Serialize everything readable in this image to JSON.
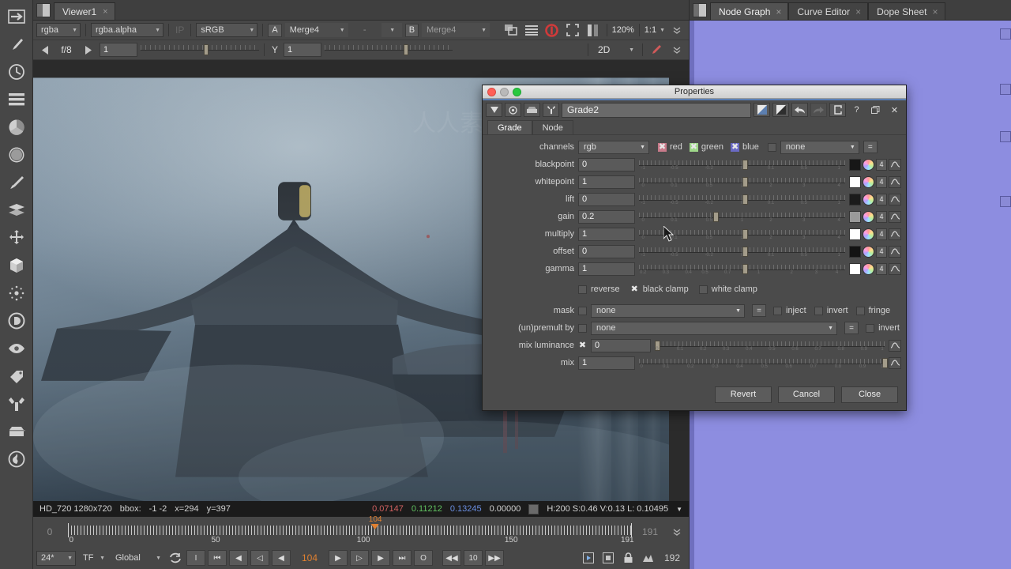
{
  "left_toolbar": {
    "tools": [
      {
        "name": "transform-node-icon",
        "label": "Transform"
      },
      {
        "name": "paint-brush-icon",
        "label": "Draw"
      },
      {
        "name": "time-clock-icon",
        "label": "Time"
      },
      {
        "name": "layers-stack-icon",
        "label": "Channel"
      },
      {
        "name": "color-wheel-icon",
        "label": "Color"
      },
      {
        "name": "filter-sphere-icon",
        "label": "Filter"
      },
      {
        "name": "keyer-eyedropper-icon",
        "label": "Keyer"
      },
      {
        "name": "merge-layers-icon",
        "label": "Merge"
      },
      {
        "name": "transform-move-icon",
        "label": "Transform"
      },
      {
        "name": "cube-3d-icon",
        "label": "3D"
      },
      {
        "name": "particles-icon",
        "label": "Particles"
      },
      {
        "name": "deep-d-icon",
        "label": "Deep"
      },
      {
        "name": "views-eye-icon",
        "label": "Views"
      },
      {
        "name": "metadata-tag-icon",
        "label": "Metadata"
      },
      {
        "name": "toolsets-wrench-icon",
        "label": "Toolsets"
      },
      {
        "name": "other-box-icon",
        "label": "Other"
      },
      {
        "name": "furnace-icon",
        "label": "Furnace"
      }
    ]
  },
  "viewer": {
    "tab_label": "Viewer1",
    "tab_close": "×",
    "channel_set": "rgba",
    "channel": "rgba.alpha",
    "ip_label": "IP",
    "colorspace": "sRGB",
    "input_a_label": "A",
    "input_a": "Merge4",
    "input_dash": "-",
    "input_b_label": "B",
    "input_b": "Merge4",
    "zoom": "120%",
    "ratio": "1:1",
    "gain_stop": "f/8",
    "gain_value": "1",
    "gamma_label": "Y",
    "gamma_value": "1",
    "view_mode": "2D",
    "icons": {
      "proxy": "proxy-icon",
      "lines": "lines-icon",
      "refresh": "refresh-icon",
      "roi": "region-of-interest-icon",
      "wipe": "wipe-icon",
      "chevron": "chevron-down-icon",
      "pen": "pen-icon"
    }
  },
  "status": {
    "format": "HD_720 1280x720",
    "bbox_label": "bbox:",
    "bbox_value": "-1 -2",
    "x": "x=294",
    "y": "y=397",
    "red": "0.07147",
    "green": "0.11212",
    "blue": "0.13245",
    "alpha": "0.00000",
    "hsvl": "H:200 S:0.46 V:0.13  L: 0.10495"
  },
  "timeline": {
    "start": "0",
    "end": "191",
    "playhead": "104",
    "labels": [
      "0",
      "50",
      "100",
      "150",
      "191"
    ],
    "label_positions": [
      0,
      26.2,
      52.4,
      78.6,
      100
    ],
    "fps": "24*",
    "fps_mode": "TF",
    "scope": "Global",
    "loop_icon": "loop-icon",
    "buttons": [
      {
        "name": "set-in-point-button",
        "glyph": "I"
      },
      {
        "name": "first-frame-button",
        "glyph": "⏮"
      },
      {
        "name": "previous-keyframe-button",
        "glyph": "◀"
      },
      {
        "name": "previous-frame-button",
        "glyph": "◁"
      },
      {
        "name": "play-backward-button",
        "glyph": "◀"
      }
    ],
    "buttons_right": [
      {
        "name": "play-forward-button",
        "glyph": "▶"
      },
      {
        "name": "next-frame-button",
        "glyph": "▷"
      },
      {
        "name": "next-keyframe-button",
        "glyph": "▶"
      },
      {
        "name": "last-frame-button",
        "glyph": "⏭"
      },
      {
        "name": "stop-button",
        "glyph": "O"
      }
    ],
    "step_back": "◀◀",
    "step_size": "10",
    "step_fwd": "▶▶",
    "end_field": "192",
    "right_icons": [
      "playback-mode-icon",
      "fullframe-icon",
      "lock-icon",
      "keyframe-icon"
    ]
  },
  "right_panel": {
    "tabs": [
      {
        "label": "Node Graph",
        "active": true,
        "close": "×"
      },
      {
        "label": "Curve Editor",
        "active": false,
        "close": "×"
      },
      {
        "label": "Dope Sheet",
        "active": false,
        "close": "×"
      }
    ],
    "node": {
      "label": "Grade2"
    }
  },
  "properties": {
    "window_title": "Properties",
    "node_name": "Grade2",
    "header_buttons": [
      {
        "name": "properties-menu-button",
        "glyph": "▼"
      },
      {
        "name": "node-color-button",
        "glyph": "●"
      },
      {
        "name": "node-mask-button",
        "glyph": "⬛"
      },
      {
        "name": "node-settings-button",
        "glyph": "⚒"
      }
    ],
    "right_buttons": [
      {
        "name": "split-view-a-button",
        "glyph": "◨"
      },
      {
        "name": "split-view-b-button",
        "glyph": "◧"
      },
      {
        "name": "undo-button",
        "glyph": "↶"
      },
      {
        "name": "redo-button",
        "glyph": "↷"
      },
      {
        "name": "revert-node-button",
        "glyph": "↻"
      },
      {
        "name": "help-button",
        "glyph": "?"
      },
      {
        "name": "float-button",
        "glyph": "❐"
      },
      {
        "name": "close-button",
        "glyph": "✕"
      }
    ],
    "tabs": [
      {
        "label": "Grade",
        "active": true
      },
      {
        "label": "Node",
        "active": false
      }
    ],
    "channels": {
      "label": "channels",
      "value": "rgb",
      "red_label": "red",
      "red_checked": true,
      "green_label": "green",
      "green_checked": true,
      "blue_label": "blue",
      "blue_checked": true,
      "alpha_checked": false,
      "alpha_value": "none",
      "equals": "="
    },
    "knobs": [
      {
        "label": "blackpoint",
        "value": "0",
        "nub_pct": 50,
        "swatch": "#171717",
        "chan": "4",
        "ticks": [
          "-1",
          "-0.5",
          "-0.2",
          "0",
          "0.1",
          "0.5",
          "1"
        ],
        "tick_pos": [
          2,
          17,
          34,
          50,
          64,
          80,
          97
        ]
      },
      {
        "label": "whitepoint",
        "value": "1",
        "nub_pct": 50,
        "swatch": "#ffffff",
        "chan": "4",
        "ticks": [
          "0",
          "0.1",
          "0.5",
          "1",
          "2",
          "3",
          "4"
        ],
        "tick_pos": [
          2,
          17,
          34,
          50,
          64,
          80,
          97
        ]
      },
      {
        "label": "lift",
        "value": "0",
        "nub_pct": 50,
        "swatch": "#1b1b1b",
        "chan": "4",
        "ticks": [
          "-1",
          "-0.5",
          "-0.2",
          "0",
          "0.1",
          "0.5",
          "1"
        ],
        "tick_pos": [
          2,
          17,
          34,
          50,
          64,
          80,
          97
        ]
      },
      {
        "label": "gain",
        "value": "0.2",
        "nub_pct": 36,
        "swatch": "#9a9a9a",
        "chan": "4",
        "ticks": [
          "0",
          "0.1",
          "0.5",
          "1",
          "2",
          "3",
          "4"
        ],
        "tick_pos": [
          2,
          17,
          34,
          50,
          64,
          80,
          97
        ]
      },
      {
        "label": "multiply",
        "value": "1",
        "nub_pct": 50,
        "swatch": "#ffffff",
        "chan": "4",
        "ticks": [
          "0",
          "0.1",
          "0.5",
          "1",
          "2",
          "3",
          "4"
        ],
        "tick_pos": [
          2,
          17,
          34,
          50,
          64,
          80,
          97
        ]
      },
      {
        "label": "offset",
        "value": "0",
        "nub_pct": 50,
        "swatch": "#131313",
        "chan": "4",
        "ticks": [
          "-1",
          "-0.5",
          "-0.2",
          "0",
          "0.1",
          "0.5",
          "1"
        ],
        "tick_pos": [
          2,
          17,
          34,
          50,
          64,
          80,
          97
        ]
      },
      {
        "label": "gamma",
        "value": "1",
        "nub_pct": 50,
        "swatch": "#ffffff",
        "chan": "4",
        "ticks": [
          "0.2",
          "0.3",
          "0.4",
          "0.5",
          "0.7",
          "1",
          "2",
          "3",
          "4"
        ],
        "tick_pos": [
          2,
          13,
          24,
          32,
          43,
          58,
          74,
          86,
          96
        ]
      }
    ],
    "clamps": {
      "reverse_label": "reverse",
      "reverse_checked": false,
      "black_clamp_label": "black clamp",
      "black_clamp_checked": true,
      "white_clamp_label": "white clamp",
      "white_clamp_checked": false
    },
    "mask": {
      "label": "mask",
      "checked": false,
      "value": "none",
      "equals": "=",
      "inject_label": "inject",
      "inject_checked": false,
      "invert_label": "invert",
      "invert_checked": false,
      "fringe_label": "fringe",
      "fringe_checked": false
    },
    "premult": {
      "label": "(un)premult by",
      "checked": false,
      "value": "none",
      "equals": "=",
      "invert_label": "invert",
      "invert_checked": false
    },
    "mix_luminance": {
      "label": "mix luminance",
      "checked": true,
      "value": "0",
      "nub_pct": 1,
      "ticks": [
        "0",
        "0.1",
        "0.2",
        "0.3",
        "0.4",
        "0.5",
        "0.6",
        "0.7",
        "0.8",
        "0.9",
        "1"
      ]
    },
    "mix": {
      "label": "mix",
      "value": "1",
      "nub_pct": 99,
      "ticks": [
        "0",
        "0.1",
        "0.2",
        "0.3",
        "0.4",
        "0.5",
        "0.6",
        "0.7",
        "0.8",
        "0.9",
        "1"
      ]
    },
    "footer": {
      "revert": "Revert",
      "cancel": "Cancel",
      "close": "Close"
    }
  },
  "watermark": "人人素材"
}
